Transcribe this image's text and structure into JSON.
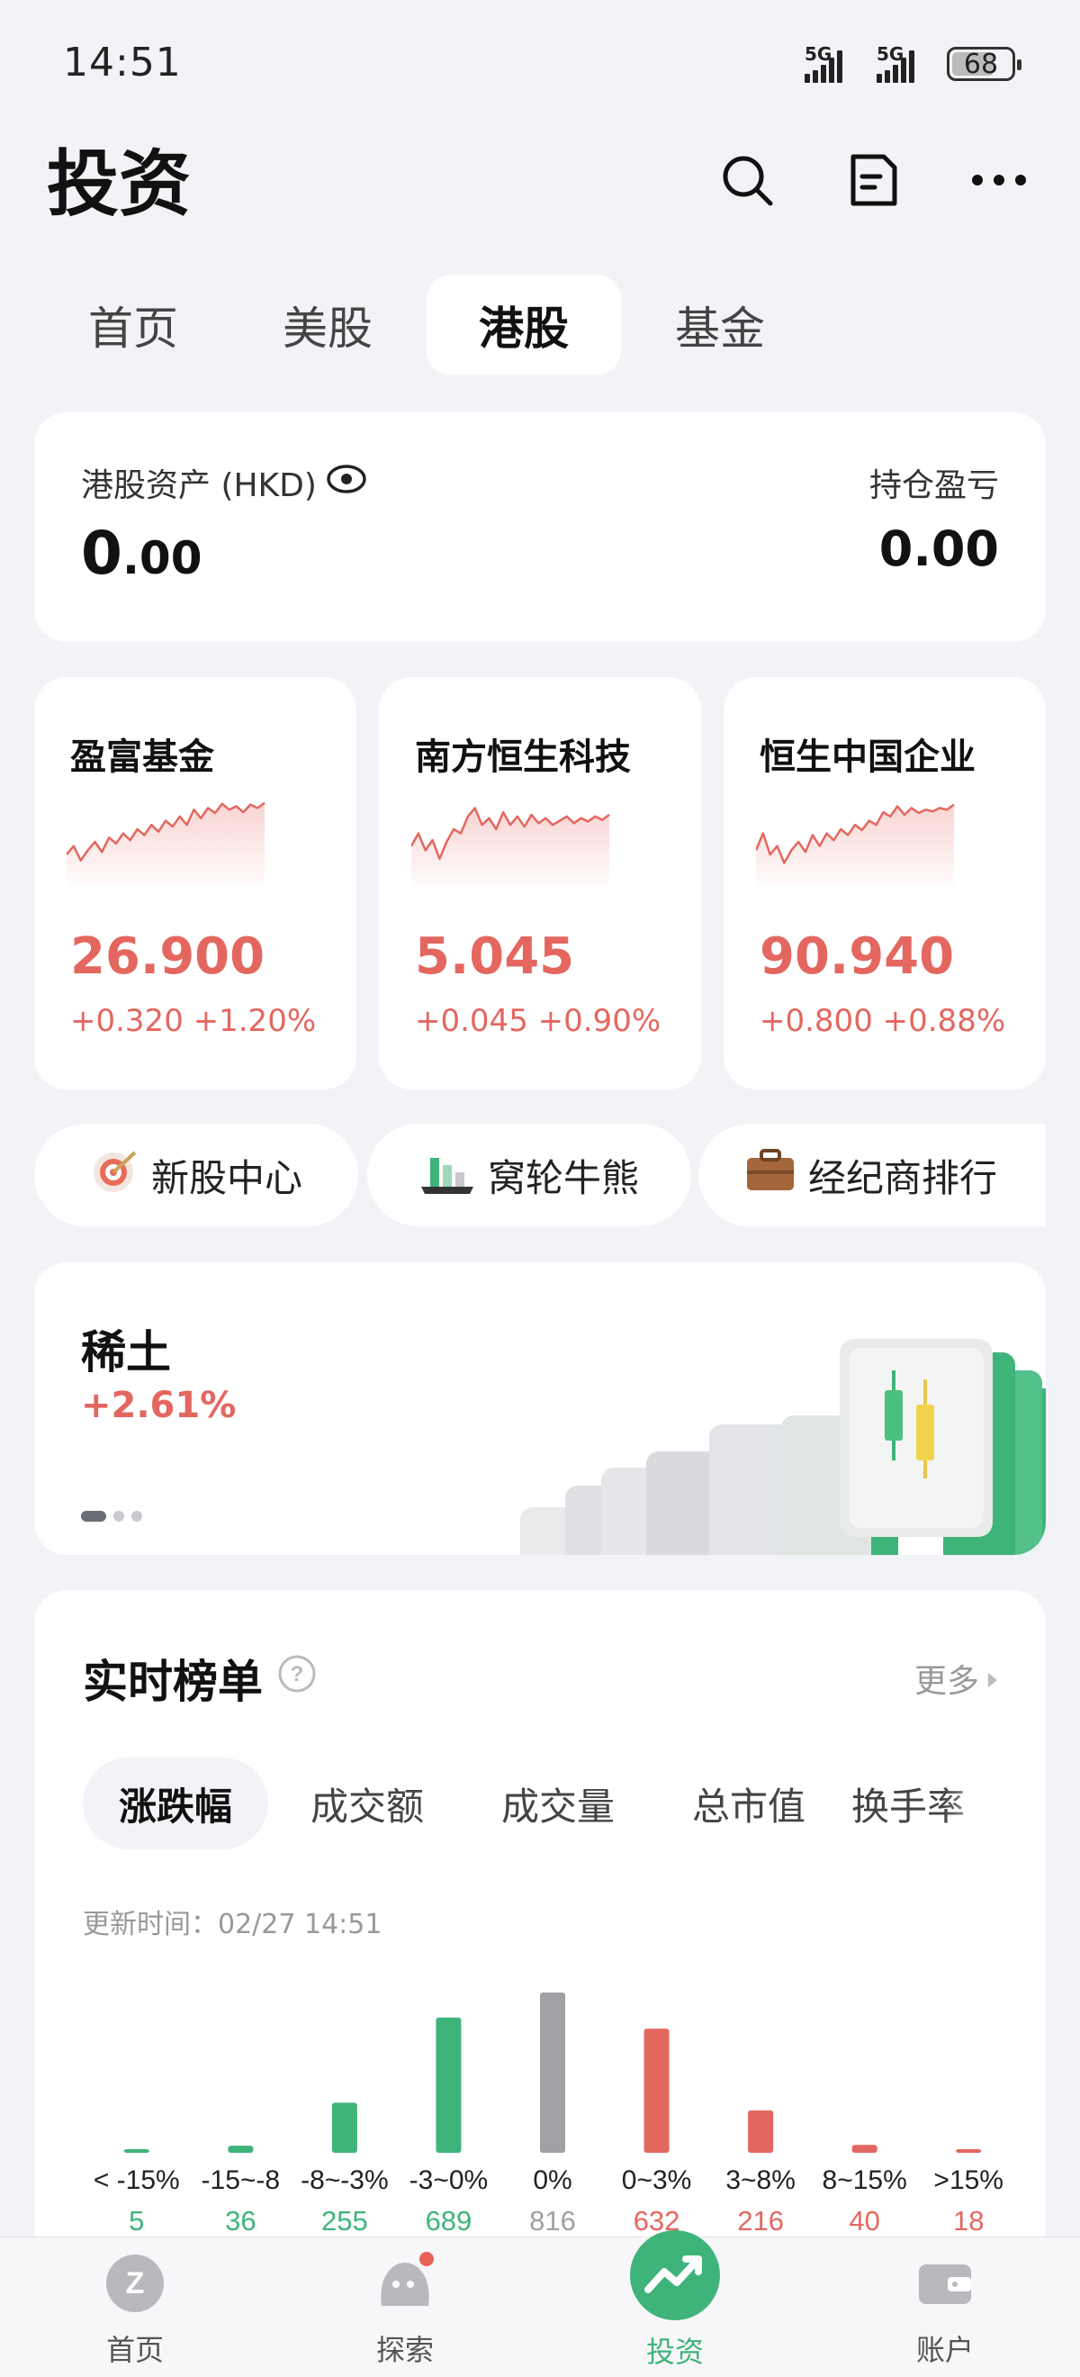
{
  "status_bar": {
    "time": "14:51",
    "network1": "5G",
    "network2": "5G",
    "battery": "68"
  },
  "header": {
    "title": "投资",
    "icons": [
      "search-icon",
      "document-icon",
      "more-icon"
    ]
  },
  "tabs": [
    {
      "label": "首页",
      "active": false
    },
    {
      "label": "美股",
      "active": false
    },
    {
      "label": "港股",
      "active": true
    },
    {
      "label": "基金",
      "active": false
    }
  ],
  "assets": {
    "label": "港股资产 (HKD)",
    "value_int": "0",
    "value_dec": ".00",
    "pnl_label": "持仓盈亏",
    "pnl_value": "0.00"
  },
  "indices": [
    {
      "name": "盈富基金",
      "price": "26.900",
      "change": "+0.320 +1.20%",
      "spark": [
        0.65,
        0.55,
        0.72,
        0.6,
        0.5,
        0.62,
        0.45,
        0.52,
        0.4,
        0.48,
        0.35,
        0.42,
        0.3,
        0.38,
        0.25,
        0.32,
        0.2,
        0.3,
        0.12,
        0.22,
        0.1,
        0.16,
        0.05,
        0.12,
        0.08,
        0.15,
        0.06,
        0.1,
        0.04
      ]
    },
    {
      "name": "南方恒生科技",
      "price": "5.045",
      "change": "+0.045 +0.90%",
      "spark": [
        0.55,
        0.4,
        0.6,
        0.48,
        0.7,
        0.5,
        0.35,
        0.4,
        0.2,
        0.1,
        0.3,
        0.22,
        0.35,
        0.15,
        0.3,
        0.2,
        0.32,
        0.18,
        0.28,
        0.22,
        0.3,
        0.25,
        0.2,
        0.28,
        0.22,
        0.26,
        0.2,
        0.24,
        0.18
      ]
    },
    {
      "name": "恒生中国企业",
      "price": "90.940",
      "change": "+0.800 +0.88%",
      "spark": [
        0.6,
        0.4,
        0.65,
        0.55,
        0.75,
        0.6,
        0.5,
        0.62,
        0.42,
        0.55,
        0.4,
        0.48,
        0.35,
        0.42,
        0.3,
        0.36,
        0.25,
        0.3,
        0.15,
        0.2,
        0.08,
        0.18,
        0.1,
        0.16,
        0.12,
        0.14,
        0.1,
        0.12,
        0.06
      ]
    }
  ],
  "shortcuts": [
    {
      "label": "新股中心",
      "icon": "target-icon"
    },
    {
      "label": "窝轮牛熊",
      "icon": "bar-chart-icon"
    },
    {
      "label": "经纪商排行",
      "icon": "briefcase-icon"
    }
  ],
  "banner": {
    "title": "稀土",
    "change": "+2.61%"
  },
  "ranking": {
    "title": "实时榜单",
    "more": "更多",
    "tabs": [
      "涨跌幅",
      "成交额",
      "成交量",
      "总市值",
      "换手率"
    ],
    "update_time": "更新时间：02/27 14:51"
  },
  "chart_data": {
    "type": "bar",
    "categories": [
      "< -15%",
      "-15~-8",
      "-8~-3%",
      "-3~0%",
      "0%",
      "0~3%",
      "3~8%",
      "8~15%",
      ">15%"
    ],
    "values": [
      5,
      36,
      255,
      689,
      816,
      632,
      216,
      40,
      18
    ],
    "colors": [
      "#3fb47a",
      "#3fb47a",
      "#3fb47a",
      "#3fb47a",
      "#a0a0a5",
      "#e4675f",
      "#e4675f",
      "#e4675f",
      "#e4675f"
    ]
  },
  "bottom_nav": [
    {
      "label": "首页",
      "icon": "home-logo-icon",
      "active": false
    },
    {
      "label": "探索",
      "icon": "explore-icon",
      "active": false
    },
    {
      "label": "投资",
      "icon": "invest-icon",
      "active": true
    },
    {
      "label": "账户",
      "icon": "wallet-icon",
      "active": false
    }
  ],
  "colors": {
    "up": "#e4675f",
    "down": "#3fb47a",
    "flat": "#a0a0a5",
    "accent": "#3fb47a"
  }
}
